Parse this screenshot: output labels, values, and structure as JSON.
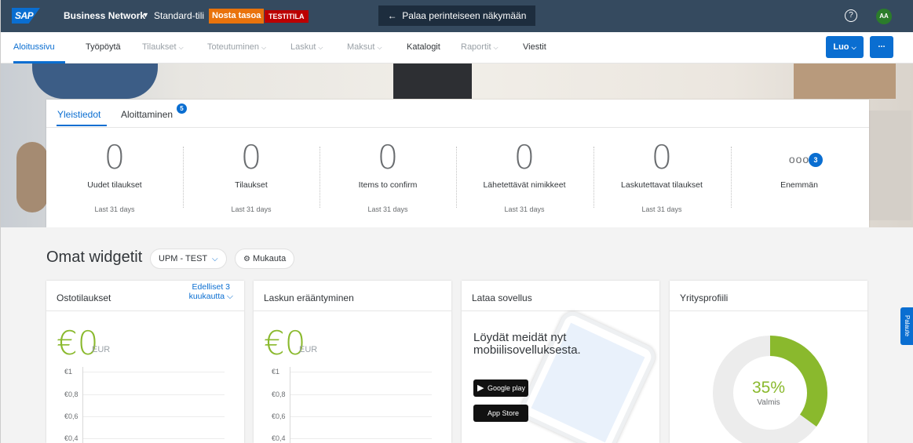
{
  "topbar": {
    "logo": "SAP",
    "product": "Business Network",
    "account": "Standard-tili",
    "upgrade": "Nosta tasoa",
    "test_badge": "TESTITILA",
    "back_button": "Palaa perinteiseen näkymään",
    "help": "?",
    "avatar": "AA"
  },
  "nav": {
    "items": [
      {
        "label": "Aloitussivu",
        "state": "active"
      },
      {
        "label": "Työpöytä",
        "state": "enabled"
      },
      {
        "label": "Tilaukset",
        "state": "disabled"
      },
      {
        "label": "Toteutuminen",
        "state": "disabled"
      },
      {
        "label": "Laskut",
        "state": "disabled"
      },
      {
        "label": "Maksut",
        "state": "disabled"
      },
      {
        "label": "Katalogit",
        "state": "enabled"
      },
      {
        "label": "Raportit",
        "state": "disabled"
      },
      {
        "label": "Viestit",
        "state": "enabled"
      }
    ],
    "create_button": "Luo",
    "more_button": "..."
  },
  "summary": {
    "tabs": [
      {
        "label": "Yleistiedot"
      },
      {
        "label": "Aloittaminen",
        "badge": "5"
      }
    ],
    "kpis": [
      {
        "value": "0",
        "label": "Uudet tilaukset",
        "period": "Last 31 days"
      },
      {
        "value": "0",
        "label": "Tilaukset",
        "period": "Last 31 days"
      },
      {
        "value": "0",
        "label": "Items to confirm",
        "period": "Last 31 days"
      },
      {
        "value": "0",
        "label": "Lähetettävät nimikkeet",
        "period": "Last 31 days"
      },
      {
        "value": "0",
        "label": "Laskutettavat tilaukset",
        "period": "Last 31 days"
      }
    ],
    "more": {
      "label": "Enemmän",
      "dots": "ooo",
      "badge": "3"
    }
  },
  "widgets": {
    "title": "Omat widgetit",
    "filter": "UPM - TEST",
    "customize": "Mukauta",
    "cards": {
      "orders": {
        "title": "Ostotilaukset",
        "period_line1": "Edelliset 3",
        "period_line2": "kuukautta",
        "value": "€0",
        "currency": "EUR",
        "ticks": [
          "€1",
          "€0,8",
          "€0,6",
          "€0,4"
        ]
      },
      "invoices": {
        "title": "Laskun erääntyminen",
        "value": "€0",
        "currency": "EUR",
        "ticks": [
          "€1",
          "€0,8",
          "€0,6",
          "€0,4"
        ]
      },
      "app": {
        "title": "Lataa sovellus",
        "text": "Löydät meidät nyt mobiilisovelluksesta.",
        "google": "Google play",
        "apple": "App Store"
      },
      "profile": {
        "title": "Yritysprofiili",
        "percent": "35%",
        "percent_value": 0.35,
        "status": "Valmis"
      }
    }
  },
  "feedback": "Palaute",
  "colors": {
    "shell": "#354a5f",
    "accent": "#0a6ed1",
    "positive": "#8ab92d",
    "upgrade": "#e9730c",
    "test": "#bb0000"
  }
}
